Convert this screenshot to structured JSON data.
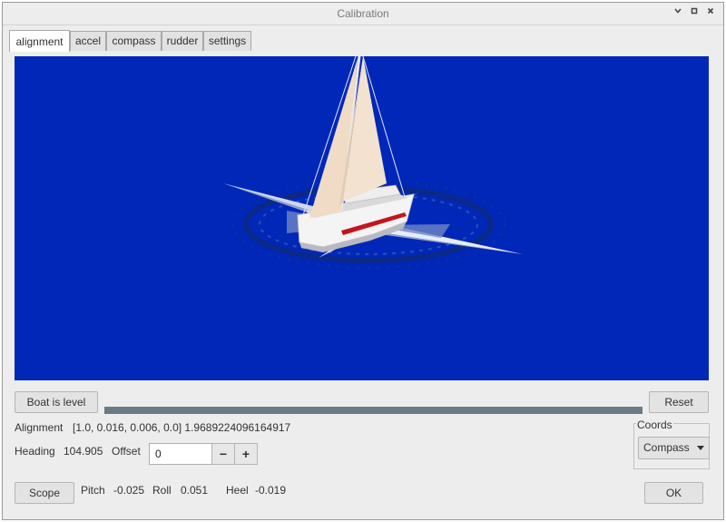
{
  "window": {
    "title": "Calibration",
    "controls": [
      "chevron-down-icon",
      "maximize-icon",
      "close-icon"
    ]
  },
  "tabs": [
    {
      "label": "alignment",
      "active": true
    },
    {
      "label": "accel",
      "active": false
    },
    {
      "label": "compass",
      "active": false
    },
    {
      "label": "rudder",
      "active": false
    },
    {
      "label": "settings",
      "active": false
    }
  ],
  "viewport": {
    "background": "#0027b8"
  },
  "boat_level_button": "Boat is level",
  "progress": {
    "value": 1.0
  },
  "reset_button": "Reset",
  "alignment": {
    "label": "Alignment",
    "value": "[1.0, 0.016, 0.006, 0.0] 1.9689224096164917"
  },
  "heading": {
    "label": "Heading",
    "value": "104.905",
    "offset_label": "Offset",
    "offset_value": "0",
    "minus": "−",
    "plus": "+"
  },
  "coords": {
    "label": "Coords",
    "selected": "Compass"
  },
  "scope_button": "Scope",
  "readings": {
    "pitch_label": "Pitch",
    "pitch_value": "-0.025",
    "roll_label": "Roll",
    "roll_value": "0.051",
    "heel_label": "Heel",
    "heel_value": "-0.019"
  },
  "ok_button": "OK"
}
